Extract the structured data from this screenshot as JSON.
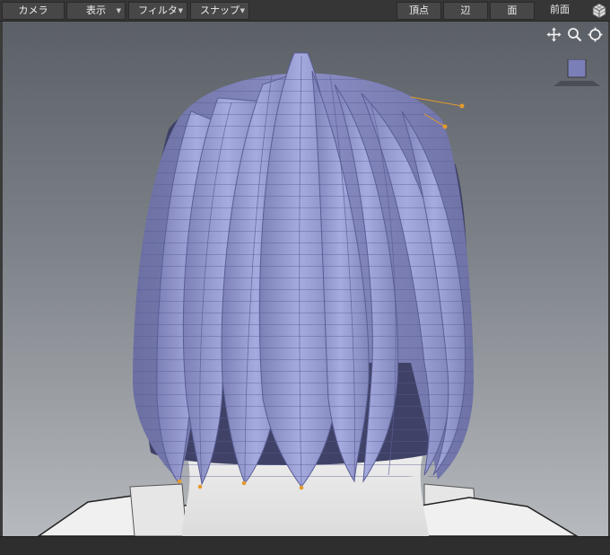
{
  "toolbar": {
    "camera_label": "カメラ",
    "display_label": "表示",
    "filter_label": "フィルタ",
    "snap_label": "スナップ",
    "vertex_label": "頂点",
    "edge_label": "辺",
    "face_label": "面",
    "view_label": "前面"
  },
  "icons": {
    "move": "move-icon",
    "zoom": "zoom-icon",
    "rotate": "rotate-icon",
    "view_cube": "view-cube-icon",
    "perspective": "perspective-icon"
  },
  "colors": {
    "hair_light": "#a4a9dd",
    "hair_dark": "#6f73a6",
    "control_point": "#e49a2c",
    "viewport_top": "#5b5f66",
    "viewport_bottom": "#b6b9bd"
  }
}
